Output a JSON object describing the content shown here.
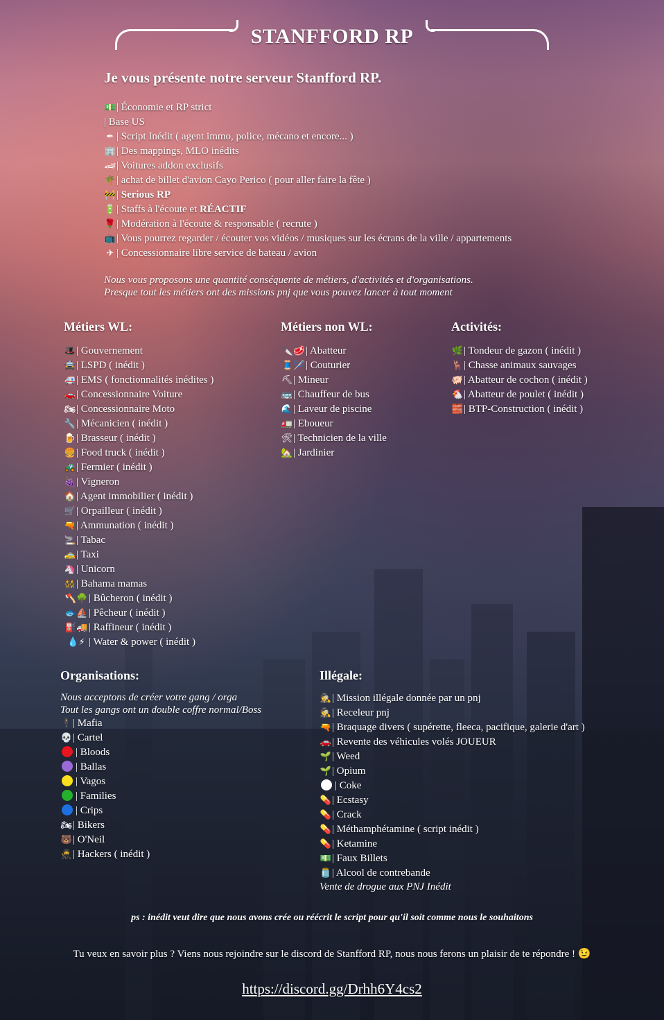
{
  "title": "STANFFORD RP",
  "intro": {
    "heading": "Je vous présente notre serveur Stanfford RP.",
    "features": [
      {
        "icon": "money-icon",
        "glyph": "💵",
        "pre": "| Économie et RP strict",
        "bold": "",
        "post": ""
      },
      {
        "icon": "",
        "glyph": "",
        "pre": "| Base US",
        "bold": "",
        "post": ""
      },
      {
        "icon": "pen-icon",
        "glyph": "✒",
        "pre": "| Script Inédit ( agent immo, police, mécano et encore... )",
        "bold": "",
        "post": ""
      },
      {
        "icon": "building-icon",
        "glyph": "🏢",
        "pre": "| Des mappings, MLO inédits",
        "bold": "",
        "post": ""
      },
      {
        "icon": "racecar-icon",
        "glyph": "🏎",
        "pre": "| Voitures addon exclusifs",
        "bold": "",
        "post": ""
      },
      {
        "icon": "palm-tree-icon",
        "glyph": "🌴",
        "pre": "| achat de billet d'avion Cayo Perico ( pour aller faire la fête )",
        "bold": "",
        "post": ""
      },
      {
        "icon": "construction-barrier-icon",
        "glyph": "🚧",
        "pre": "| ",
        "bold": "Serious RP",
        "post": ""
      },
      {
        "icon": "battery-icon",
        "glyph": "🔋",
        "pre": "| Staffs à l'écoute et ",
        "bold": "RÉACTIF",
        "post": ""
      },
      {
        "icon": "rose-icon",
        "glyph": "🌹",
        "pre": "| Modération à l'écoute & responsable ( recrute )",
        "bold": "",
        "post": ""
      },
      {
        "icon": "tv-icon",
        "glyph": "📺",
        "pre": "| Vous pourrez regarder / écouter vos vidéos / musiques sur les écrans de la ville / appartements",
        "bold": "",
        "post": ""
      },
      {
        "icon": "airplane-icon",
        "glyph": "✈",
        "pre": "| Concessionnaire libre service de bateau / avion",
        "bold": "",
        "post": ""
      }
    ],
    "italic_lines": [
      "Nous vous proposons une quantité conséquente de métiers, d'activités et d'organisations.",
      "Presque tout les métiers ont des missions pnj que vous pouvez lancer à tout moment"
    ]
  },
  "metiers_wl": {
    "heading": "Métiers WL:",
    "items": [
      {
        "icon": "tophat-icon",
        "glyph": "🎩",
        "text": "| Gouvernement"
      },
      {
        "icon": "police-car-icon",
        "glyph": "🚔",
        "text": "| LSPD ( inédit )"
      },
      {
        "icon": "ambulance-icon",
        "glyph": "🚑",
        "text": "| EMS ( fonctionnalités inédites )"
      },
      {
        "icon": "car-icon",
        "glyph": "🚗",
        "text": "| Concessionnaire Voiture"
      },
      {
        "icon": "motorcycle-icon",
        "glyph": "🏍",
        "text": "| Concessionnaire Moto"
      },
      {
        "icon": "wrench-icon",
        "glyph": "🔧",
        "text": "| Mécanicien ( inédit )"
      },
      {
        "icon": "beer-icon",
        "glyph": "🍺",
        "text": "| Brasseur ( inédit )"
      },
      {
        "icon": "burger-icon",
        "glyph": "🍔",
        "text": "| Food truck ( inédit )"
      },
      {
        "icon": "tractor-icon",
        "glyph": "🚜",
        "text": "| Fermier ( inédit )"
      },
      {
        "icon": "grapes-icon",
        "glyph": "🍇",
        "text": "| Vigneron"
      },
      {
        "icon": "house-icon",
        "glyph": "🏠",
        "text": "| Agent immobilier ( inédit )"
      },
      {
        "icon": "minecart-icon",
        "glyph": "🛒",
        "text": "| Orpailleur ( inédit )"
      },
      {
        "icon": "gun-icon",
        "glyph": "🔫",
        "text": "| Ammunation ( inédit )"
      },
      {
        "icon": "cigarette-icon",
        "glyph": "🚬",
        "text": "| Tabac"
      },
      {
        "icon": "taxi-icon",
        "glyph": "🚕",
        "text": "| Taxi"
      },
      {
        "icon": "unicorn-icon",
        "glyph": "🦄",
        "text": "| Unicorn"
      },
      {
        "icon": "dancers-icon",
        "glyph": "👯",
        "text": "| Bahama mamas"
      },
      {
        "icon": "axe-tree-icon",
        "glyph": "🪓🌳",
        "text": "| Bûcheron ( inédit )"
      },
      {
        "icon": "fish-boat-icon",
        "glyph": "🐟⛵",
        "text": "| Pêcheur ( inédit )"
      },
      {
        "icon": "fuel-truck-icon",
        "glyph": "⛽🚚",
        "text": "| Raffineur ( inédit )"
      },
      {
        "icon": "water-power-icon",
        "glyph": "💧⚡",
        "text": "| Water & power ( inédit )"
      }
    ]
  },
  "metiers_non_wl": {
    "heading": "Métiers non WL:",
    "items": [
      {
        "icon": "knife-meat-icon",
        "glyph": "🔪🥩",
        "text": "| Abatteur"
      },
      {
        "icon": "sewing-icon",
        "glyph": "🧵🪡",
        "text": "| Couturier"
      },
      {
        "icon": "pickaxe-icon",
        "glyph": "⛏",
        "text": "| Mineur"
      },
      {
        "icon": "bus-icon",
        "glyph": "🚌",
        "text": "| Chauffeur de bus"
      },
      {
        "icon": "wave-icon",
        "glyph": "🌊",
        "text": "| Laveur de piscine"
      },
      {
        "icon": "garbage-truck-icon",
        "glyph": "🚛",
        "text": "| Eboueur"
      },
      {
        "icon": "tools-icon",
        "glyph": "🛠",
        "text": "| Technicien de la ville"
      },
      {
        "icon": "mountain-house-icon",
        "glyph": "🏡",
        "text": "| Jardinier"
      }
    ]
  },
  "activites": {
    "heading": "Activités:",
    "items": [
      {
        "icon": "herb-icon",
        "glyph": "🌿",
        "text": "| Tondeur de gazon ( inédit )"
      },
      {
        "icon": "deer-icon",
        "glyph": "🦌",
        "text": "| Chasse animaux sauvages"
      },
      {
        "icon": "pig-icon",
        "glyph": "🐖",
        "text": "| Abatteur de cochon ( inédit )"
      },
      {
        "icon": "chicken-icon",
        "glyph": "🐔",
        "text": "| Abatteur de poulet ( inédit )"
      },
      {
        "icon": "brick-icon",
        "glyph": "🧱",
        "text": "| BTP-Construction ( inédit )"
      }
    ]
  },
  "organisations": {
    "heading": "Organisations:",
    "notes": [
      "Nous acceptons de créer votre gang / orga",
      "Tout les gangs ont un double coffre normal/Boss"
    ],
    "items": [
      {
        "icon": "suit-man-icon",
        "glyph": "🕴",
        "color": "",
        "text": "| Mafia"
      },
      {
        "icon": "skull-icon",
        "glyph": "💀",
        "color": "",
        "text": "| Cartel"
      },
      {
        "icon": "red-circle-icon",
        "glyph": "",
        "color": "#e8141e",
        "text": "| Bloods"
      },
      {
        "icon": "purple-circle-icon",
        "glyph": "",
        "color": "#9b6ad6",
        "text": "| Ballas"
      },
      {
        "icon": "yellow-circle-icon",
        "glyph": "",
        "color": "#f9e01c",
        "text": "| Vagos"
      },
      {
        "icon": "green-circle-icon",
        "glyph": "",
        "color": "#24b22c",
        "text": "| Families"
      },
      {
        "icon": "blue-circle-icon",
        "glyph": "",
        "color": "#1e6fe0",
        "text": "| Crips"
      },
      {
        "icon": "motorcycle-rider-icon",
        "glyph": "🏍",
        "color": "",
        "text": "| Bikers"
      },
      {
        "icon": "bear-icon",
        "glyph": "🐻",
        "color": "",
        "text": "| O'Neil"
      },
      {
        "icon": "ninja-icon",
        "glyph": "🥷",
        "color": "",
        "text": "| Hackers ( inédit )"
      }
    ]
  },
  "illegale": {
    "heading": "Illégale:",
    "items": [
      {
        "icon": "detective-icon",
        "glyph": "🕵",
        "color": "",
        "text": "| Mission illégale donnée par un pnj"
      },
      {
        "icon": "detective-icon",
        "glyph": "🕵",
        "color": "",
        "text": "| Receleur pnj"
      },
      {
        "icon": "gun-icon",
        "glyph": "🔫",
        "color": "",
        "text": "| Braquage divers ( supérette, fleeca, pacifique, galerie d'art )"
      },
      {
        "icon": "car-icon",
        "glyph": "🚗",
        "color": "",
        "text": "| Revente des véhicules volés JOUEUR"
      },
      {
        "icon": "seedling-icon",
        "glyph": "🌱",
        "color": "",
        "text": "| Weed"
      },
      {
        "icon": "seedling-icon",
        "glyph": "🌱",
        "color": "",
        "text": "| Opium"
      },
      {
        "icon": "white-circle-icon",
        "glyph": "",
        "color": "#ffffff",
        "text": "| Coke"
      },
      {
        "icon": "pill-icon",
        "glyph": "💊",
        "color": "",
        "text": "| Ecstasy"
      },
      {
        "icon": "pill-icon",
        "glyph": "💊",
        "color": "",
        "text": "| Crack"
      },
      {
        "icon": "pill-icon",
        "glyph": "💊",
        "color": "",
        "text": "| Méthamphétamine ( script inédit )"
      },
      {
        "icon": "pill-icon",
        "glyph": "💊",
        "color": "",
        "text": "| Ketamine"
      },
      {
        "icon": "money-icon",
        "glyph": "💵",
        "color": "",
        "text": "| Faux Billets"
      },
      {
        "icon": "jar-icon",
        "glyph": "🫙",
        "color": "",
        "text": "| Alcool de contrebande"
      }
    ],
    "note": "Vente de drogue aux PNJ Inédit"
  },
  "ps": "ps : inédit veut dire que nous avons crée ou réécrit le script pour qu'il soit comme nous le souhaitons",
  "cta": "Tu veux en savoir plus ? Viens nous rejoindre sur le discord de Stanfford RP, nous nous ferons un plaisir de te répondre ! 😉",
  "discord_link": "https://discord.gg/Drhh6Y4cs2"
}
